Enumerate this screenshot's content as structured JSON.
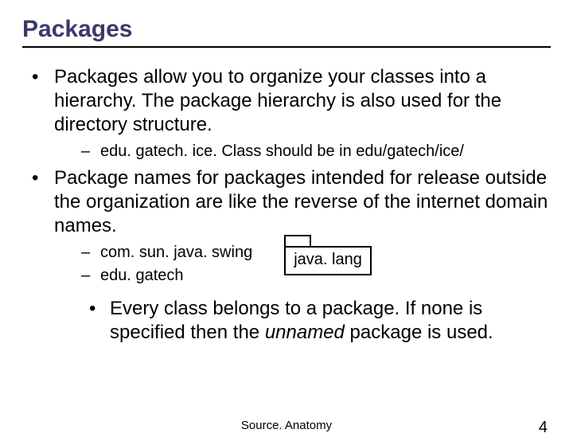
{
  "title": "Packages",
  "bullets": {
    "b1": "Packages allow you to organize your classes into a hierarchy.  The package hierarchy is also used for the directory structure.",
    "b1_sub1": "edu. gatech. ice. Class should be in edu/gatech/ice/",
    "b2": "Package names for packages intended for release outside the organization are like the reverse of the internet domain names.",
    "b2_sub1": "com. sun. java. swing",
    "b2_sub2": "edu. gatech",
    "b2_lvl3_pre": "Every class belongs to a package.  If none is specified then the ",
    "b2_lvl3_em": "unnamed",
    "b2_lvl3_post": " package is used."
  },
  "package_icon_label": "java. lang",
  "footer_center": "Source. Anatomy",
  "footer_right": "4"
}
